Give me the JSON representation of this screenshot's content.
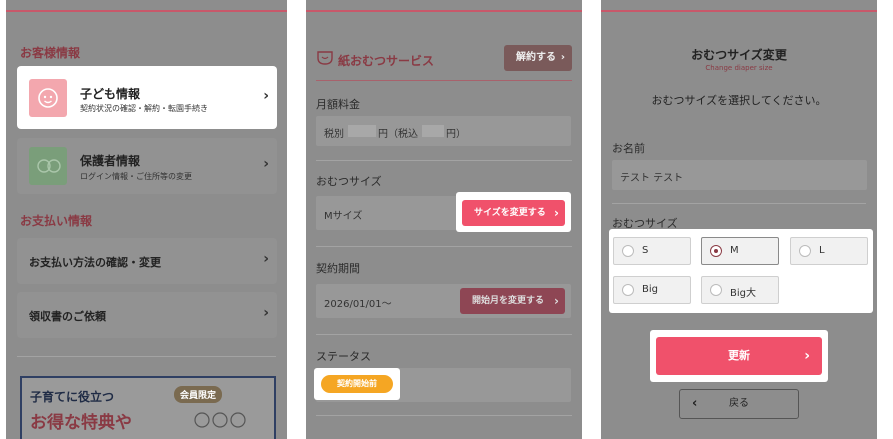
{
  "panel1": {
    "customer_info_heading": "お客様情報",
    "child_info": {
      "title": "子ども情報",
      "subtitle": "契約状況の確認・解約・転園手続き"
    },
    "guardian_info": {
      "title": "保護者情報",
      "subtitle": "ログイン情報・ご住所等の変更"
    },
    "payment_heading": "お支払い情報",
    "payment_method": "お支払い方法の確認・変更",
    "receipt_request": "領収書のご依頼",
    "banner": {
      "line1": "子育てに役立つ",
      "line2": "お得な特典や",
      "badge": "会員限定"
    }
  },
  "panel2": {
    "service_title": "紙おむつサービス",
    "cancel_button": "解約する",
    "monthly_fee_label": "月額料金",
    "monthly_fee_prefix": "税別",
    "monthly_fee_mid": "円（税込",
    "monthly_fee_suffix": "円）",
    "diaper_size_label": "おむつサイズ",
    "diaper_size_value": "Mサイズ",
    "change_size_button": "サイズを変更する",
    "contract_period_label": "契約期間",
    "contract_period_value": "2026/01/01〜",
    "change_start_button": "開始月を変更する",
    "status_label": "ステータス",
    "status_badge": "契約開始前"
  },
  "panel3": {
    "title": "おむつサイズ変更",
    "subtitle": "Change diaper size",
    "instruction": "おむつサイズを選択してください。",
    "name_label": "お名前",
    "name_value": "テスト テスト",
    "size_label": "おむつサイズ",
    "sizes": [
      "S",
      "M",
      "L",
      "Big",
      "Big大"
    ],
    "selected_size": "M",
    "update_button": "更新",
    "back_button": "戻る"
  },
  "colors": {
    "accent": "#f0516b",
    "status_badge": "#f5a623",
    "overlay": "#8d8d8d"
  }
}
